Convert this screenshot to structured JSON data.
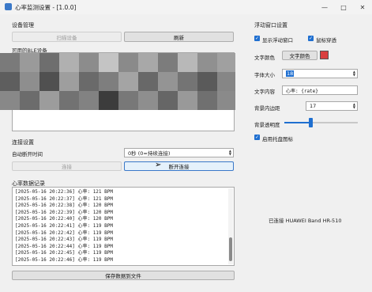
{
  "window": {
    "title": "心率监测设置 - [1.0.0]",
    "controls": [
      "minimize",
      "maximize",
      "close"
    ]
  },
  "device": {
    "group_title": "设备管理",
    "scan_button": "扫描设备",
    "refresh_button": "刷新",
    "ble_list_label": "可用的BLE设备"
  },
  "connection": {
    "group_title": "连接设置",
    "auto_disconnect_label": "自动断开时间",
    "auto_disconnect_value": "0秒 (0=持续连接)",
    "connect_button": "连接",
    "disconnect_button": "断开连接"
  },
  "log": {
    "group_title": "心率数据记录",
    "lines": [
      "[2025-05-16 20:22:36] 心率: 121 BPM",
      "[2025-05-16 20:22:37] 心率: 121 BPM",
      "[2025-05-16 20:22:38] 心率: 120 BPM",
      "[2025-05-16 20:22:39] 心率: 120 BPM",
      "[2025-05-16 20:22:40] 心率: 120 BPM",
      "[2025-05-16 20:22:41] 心率: 119 BPM",
      "[2025-05-16 20:22:42] 心率: 119 BPM",
      "[2025-05-16 20:22:43] 心率: 119 BPM",
      "[2025-05-16 20:22:44] 心率: 119 BPM",
      "[2025-05-16 20:22:45] 心率: 119 BPM",
      "[2025-05-16 20:22:46] 心率: 119 BPM"
    ],
    "save_button": "保存数据到文件"
  },
  "floating": {
    "group_title": "浮动窗口设置",
    "show_floating_label": "显示浮动窗口",
    "show_floating_checked": true,
    "mouse_through_label": "鼠标穿透",
    "mouse_through_checked": true,
    "text_color_label": "文字颜色",
    "text_color_button": "文字颜色",
    "text_color_swatch": "#d94040",
    "font_size_label": "字体大小",
    "font_size_value": "18",
    "text_content_label": "文字内容",
    "text_content_value": "心率: {rate}",
    "bg_padding_label": "背景内边距",
    "bg_padding_value": "17",
    "bg_opacity_label": "背景透明度",
    "bg_opacity_fraction": 0.35,
    "tray_icon_label": "启用托盘图标",
    "tray_icon_checked": true
  },
  "status": {
    "text": "已连接 HUAWEI Band HR-510"
  },
  "colors": {
    "accent": "#1f6fd0",
    "window_bg": "#f0f0f0"
  }
}
